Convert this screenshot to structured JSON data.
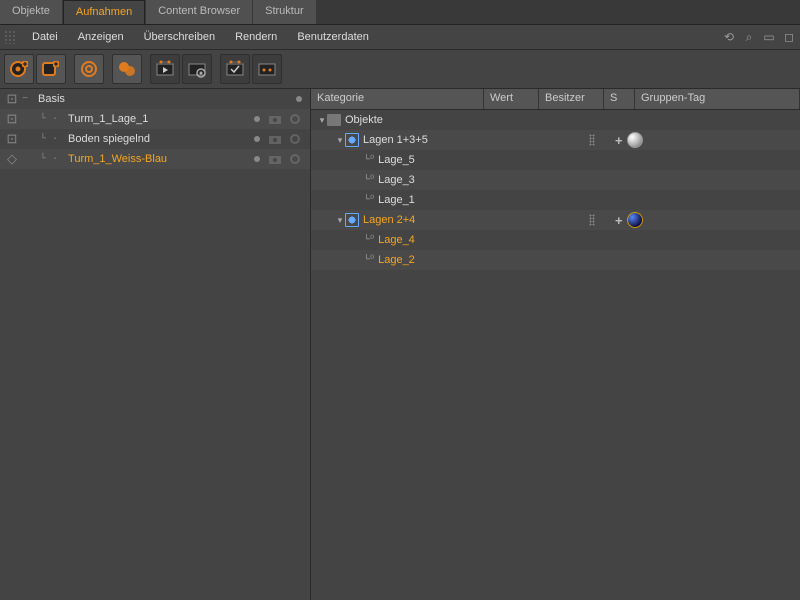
{
  "tabs": [
    "Objekte",
    "Aufnahmen",
    "Content Browser",
    "Struktur"
  ],
  "active_tab": 1,
  "menu": [
    "Datei",
    "Anzeigen",
    "Überschreiben",
    "Rendern",
    "Benutzerdaten"
  ],
  "left_tree": [
    {
      "label": "Basis",
      "hl": false,
      "dot": true,
      "acts": false,
      "indent": 0,
      "twisty": "−",
      "vis": "dashed"
    },
    {
      "label": "Turm_1_Lage_1",
      "hl": false,
      "dot": true,
      "acts": true,
      "indent": 1,
      "twisty": "",
      "vis": "dashed"
    },
    {
      "label": "Boden spiegelnd",
      "hl": false,
      "dot": true,
      "acts": true,
      "indent": 1,
      "twisty": "",
      "vis": "dashed"
    },
    {
      "label": "Turm_1_Weiss-Blau",
      "hl": true,
      "dot": true,
      "acts": true,
      "indent": 1,
      "twisty": "",
      "vis": "solid"
    }
  ],
  "right_headers": {
    "kat": "Kategorie",
    "wert": "Wert",
    "bes": "Besitzer",
    "s": "S",
    "tag": "Gruppen-Tag"
  },
  "right_rows": [
    {
      "type": "folder",
      "label": "Objekte",
      "indent": 0,
      "twisty": "▾",
      "hl": false,
      "s": "",
      "tag": ""
    },
    {
      "type": "take",
      "label": "Lagen 1+3+5",
      "indent": 1,
      "twisty": "▾",
      "hl": false,
      "s": "dots",
      "tag": "sphere-lt"
    },
    {
      "type": "layer",
      "label": "Lage_5",
      "indent": 2,
      "twisty": "",
      "hl": false,
      "s": "",
      "tag": ""
    },
    {
      "type": "layer",
      "label": "Lage_3",
      "indent": 2,
      "twisty": "",
      "hl": false,
      "s": "",
      "tag": ""
    },
    {
      "type": "layer",
      "label": "Lage_1",
      "indent": 2,
      "twisty": "",
      "hl": false,
      "s": "",
      "tag": ""
    },
    {
      "type": "take",
      "label": "Lagen 2+4",
      "indent": 1,
      "twisty": "▾",
      "hl": true,
      "s": "dots",
      "tag": "sphere-bl"
    },
    {
      "type": "layer",
      "label": "Lage_4",
      "indent": 2,
      "twisty": "",
      "hl": true,
      "s": "",
      "tag": ""
    },
    {
      "type": "layer",
      "label": "Lage_2",
      "indent": 2,
      "twisty": "",
      "hl": true,
      "s": "",
      "tag": ""
    }
  ]
}
